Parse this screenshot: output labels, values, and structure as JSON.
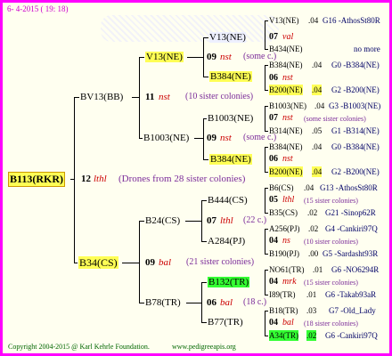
{
  "header": {
    "date": "6-  4-2015 ( 19: 18)"
  },
  "root": {
    "name": "B113(RKR)",
    "gen": "12",
    "sym": "lthl",
    "note": "(Drones from 28 sister colonies)"
  },
  "bv13": {
    "name": "BV13(BB)",
    "gen": "11",
    "sym": "nst",
    "note": "(10 sister colonies)",
    "v13": {
      "name": "V13(NE)",
      "gen": "09",
      "sym": "nst",
      "note": "(some c.)",
      "v13ne2": {
        "name": "V13(NE)",
        "gen": "07",
        "sym": "val",
        "r1": {
          "name": "V13(NE)",
          "yr": ".04",
          "code": "G16 -AthosSt80R"
        },
        "r2": {
          "name": "B434(NE)",
          "yr": "",
          "code": "no more"
        }
      },
      "b384": {
        "name": "B384(NE)",
        "gen": "06",
        "sym": "nst",
        "r1": {
          "name": "B384(NE)",
          "yr": ".04",
          "code": "G0 -B384(NE)"
        },
        "r2": {
          "name": "B200(NE)",
          "yr": ".04",
          "code": "G2 -B200(NE)"
        }
      }
    },
    "b1003": {
      "name": "B1003(NE)",
      "gen": "09",
      "sym": "nst",
      "note": "(some c.)",
      "b1003b": {
        "name": "B1003(NE)",
        "gen": "07",
        "sym": "nst",
        "note": "(some sister colonies)",
        "r1": {
          "name": "B1003(NE)",
          "yr": ".04",
          "code": "G3 -B1003(NE)"
        },
        "r2": {
          "name": "B314(NE)",
          "yr": ".05",
          "code": "G1 -B314(NE)"
        }
      },
      "b384": {
        "name": "B384(NE)",
        "gen": "06",
        "sym": "nst",
        "r1": {
          "name": "B384(NE)",
          "yr": ".04",
          "code": "G0 -B384(NE)"
        },
        "r2": {
          "name": "B200(NE)",
          "yr": ".04",
          "code": "G2 -B200(NE)"
        }
      }
    }
  },
  "b34": {
    "name": "B34(CS)",
    "gen": "09",
    "sym": "bal",
    "note": "(21 sister colonies)",
    "b24": {
      "name": "B24(CS)",
      "gen": "07",
      "sym": "lthl",
      "note": "(22 c.)",
      "b444": {
        "name": "B444(CS)",
        "gen": "05",
        "sym": "lthl",
        "note": "(15 sister colonies)",
        "r1": {
          "name": "B6(CS)",
          "yr": ".04",
          "code": "G13 -AthosSt80R"
        },
        "r2": {
          "name": "B35(CS)",
          "yr": ".02",
          "code": "G21 -Sinop62R"
        }
      },
      "a284": {
        "name": "A284(PJ)",
        "gen": "04",
        "sym": "ns",
        "note": "(10 sister colonies)",
        "r1": {
          "name": "A256(PJ)",
          "yr": ".02",
          "code": "G4 -Cankiri97Q"
        },
        "r2": {
          "name": "B190(PJ)",
          "yr": ".00",
          "code": "G5 -Sardasht93R"
        }
      }
    },
    "b78": {
      "name": "B78(TR)",
      "gen": "06",
      "sym": "bal",
      "note": "(18 c.)",
      "b132": {
        "name": "B132(TR)",
        "gen": "04",
        "sym": "mrk",
        "note": "(15 sister colonies)",
        "r1": {
          "name": "NO61(TR)",
          "yr": ".01",
          "code": "G6 -NO6294R"
        },
        "r2": {
          "name": "I89(TR)",
          "yr": ".01",
          "code": "G6 -Takab93aR"
        }
      },
      "b77": {
        "name": "B77(TR)",
        "gen": "04",
        "sym": "bal",
        "note": "(18 sister colonies)",
        "r1": {
          "name": "B18(TR)",
          "yr": ".03",
          "code": "G7 -Old_Lady"
        },
        "r2": {
          "name": "A34(TR)",
          "yr": ".02",
          "code": "G6 -Cankiri97Q"
        }
      }
    }
  },
  "footer": {
    "copyright": "Copyright 2004-2015 @ Karl Kehrle Foundation.",
    "site": "www.pedigreeapis.org"
  },
  "colors": {
    "frame": "#ff00ff",
    "highlight": "#ffff55",
    "green_highlight": "#33ff33",
    "symbol": "#cc0000",
    "note": "#7a2a99",
    "code": "#000066"
  }
}
